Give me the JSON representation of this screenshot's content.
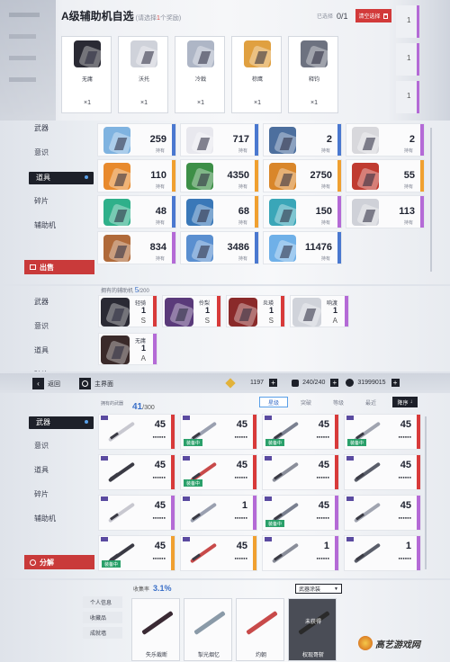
{
  "top": {
    "title": "A级辅助机自选",
    "subtitle_pre": "(请选择",
    "subtitle_count": "1",
    "subtitle_post": "个奖励)",
    "selected_label": "已选择",
    "selected_value": "0/1",
    "clear_button": "清空选择",
    "side_counts": [
      "1",
      "1",
      "1"
    ],
    "cards": [
      {
        "name": "无庸",
        "qty": "×1"
      },
      {
        "name": "沃托",
        "qty": "×1"
      },
      {
        "name": "冷戟",
        "qty": "×1"
      },
      {
        "name": "棕鹰",
        "qty": "×1"
      },
      {
        "name": "释钧",
        "qty": "×1"
      }
    ]
  },
  "items_panel": {
    "nav": [
      "武器",
      "意识",
      "道具",
      "碎片",
      "辅助机"
    ],
    "active_nav": "道具",
    "sell_button": "出售",
    "owned_label": "持有",
    "items": [
      {
        "count": "259",
        "color": "#7fb3e0",
        "stripe": "#4a78d0"
      },
      {
        "count": "717",
        "color": "#e8e8ee",
        "stripe": "#4a78d0"
      },
      {
        "count": "2",
        "color": "#4d6f9e",
        "stripe": "#4a78d0"
      },
      {
        "count": "2",
        "color": "#d8d8dc",
        "stripe": "#b46ad6"
      },
      {
        "count": "110",
        "color": "#e88a2d",
        "stripe": "#f0a030"
      },
      {
        "count": "4350",
        "color": "#3d8f47",
        "stripe": "#f0a030"
      },
      {
        "count": "2750",
        "color": "#d9862a",
        "stripe": "#f0a030"
      },
      {
        "count": "55",
        "color": "#c03b30",
        "stripe": "#f0a030"
      },
      {
        "count": "48",
        "color": "#2fb08a",
        "stripe": "#4a78d0"
      },
      {
        "count": "68",
        "color": "#3a78b8",
        "stripe": "#f0a030"
      },
      {
        "count": "150",
        "color": "#3aa6b8",
        "stripe": "#b46ad6"
      },
      {
        "count": "113",
        "color": "#cfd1d8",
        "stripe": "#b46ad6"
      },
      {
        "count": "834",
        "color": "#b06a3a",
        "stripe": "#b46ad6"
      },
      {
        "count": "3486",
        "color": "#5a8fd0",
        "stripe": "#4a78d0"
      },
      {
        "count": "11476",
        "color": "#6fb0e8",
        "stripe": "#4a78d0"
      }
    ]
  },
  "assist_panel": {
    "nav": [
      "武器",
      "意识",
      "道具",
      "碎片"
    ],
    "owned_header": "拥有的辅助机",
    "owned_value": "5",
    "owned_total": "/200",
    "units": [
      {
        "name": "轻骑",
        "level": "1",
        "grade": "S"
      },
      {
        "name": "伶梨",
        "level": "1",
        "grade": "S"
      },
      {
        "name": "炎瑛",
        "level": "1",
        "grade": "S"
      },
      {
        "name": "响渡",
        "level": "1",
        "grade": "A"
      },
      {
        "name": "无庸",
        "level": "1",
        "grade": "A"
      }
    ]
  },
  "weapon_panel": {
    "back_label": "返回",
    "home_label": "主界面",
    "currency": [
      "1197",
      "240/240",
      "31999015"
    ],
    "owned_label": "拥有的武器",
    "owned_value": "41",
    "owned_total": "/300",
    "tabs": [
      "星级",
      "突破",
      "等级",
      "最近"
    ],
    "active_tab": "星级",
    "sort_label": "降序",
    "nav": [
      "武器",
      "意识",
      "道具",
      "碎片",
      "辅助机"
    ],
    "active_nav": "武器",
    "dismantle_button": "分解",
    "equipped_label": "装备中",
    "stars": "●●●●●●",
    "weapons": [
      {
        "level": "45",
        "stripe": "#d83a3a",
        "equipped": false
      },
      {
        "level": "45",
        "stripe": "#d83a3a",
        "equipped": true
      },
      {
        "level": "45",
        "stripe": "#d83a3a",
        "equipped": true
      },
      {
        "level": "45",
        "stripe": "#d83a3a",
        "equipped": true
      },
      {
        "level": "45",
        "stripe": "#d83a3a",
        "equipped": false
      },
      {
        "level": "45",
        "stripe": "#d83a3a",
        "equipped": true
      },
      {
        "level": "45",
        "stripe": "#d83a3a",
        "equipped": false
      },
      {
        "level": "45",
        "stripe": "#d83a3a",
        "equipped": false
      },
      {
        "level": "45",
        "stripe": "#b46ad6",
        "equipped": false
      },
      {
        "level": "1",
        "stripe": "#b46ad6",
        "equipped": false
      },
      {
        "level": "45",
        "stripe": "#b46ad6",
        "equipped": true
      },
      {
        "level": "45",
        "stripe": "#b46ad6",
        "equipped": false
      },
      {
        "level": "45",
        "stripe": "#f0a030",
        "equipped": true
      },
      {
        "level": "45",
        "stripe": "#f0a030",
        "equipped": false
      },
      {
        "level": "1",
        "stripe": "#b46ad6",
        "equipped": false
      },
      {
        "level": "1",
        "stripe": "#b46ad6",
        "equipped": false
      }
    ]
  },
  "collection_panel": {
    "nav": [
      "个人信息",
      "收藏品",
      "成就墙"
    ],
    "rate_label": "收集率",
    "rate_value": "3.1%",
    "dropdown": "武器涂装",
    "not_owned": "未获得",
    "skins": [
      "失乐裁断",
      "掣光烟忆",
      "灼朝",
      "权现哥斩"
    ]
  },
  "watermark": "高艺游戏网"
}
